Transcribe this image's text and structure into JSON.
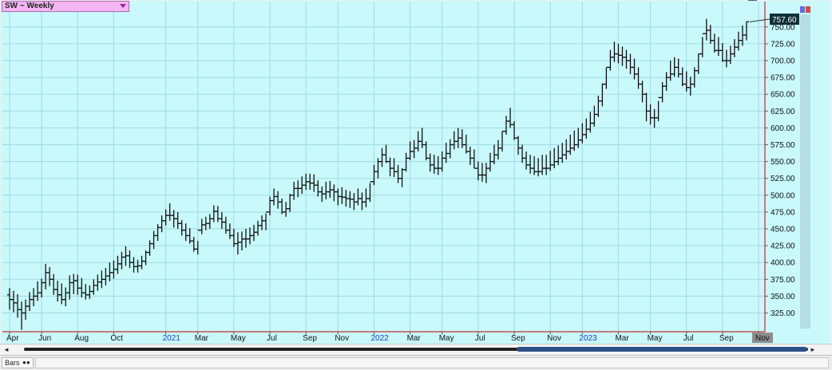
{
  "window": {
    "symbol_label": "SW ~ Weekly",
    "dropdown_icon": "chevron-down-icon",
    "status_tab_label": "Bars",
    "status_tab_icon": "infinity-icon"
  },
  "colors": {
    "plot_background": "#c9f9fb",
    "gridline": "#9fd9e4",
    "axis_line": "#c00000",
    "bar": "#111111",
    "price_label_bg": "#0f2f3a",
    "year_label": "#1a3fbf",
    "scroll_thumb": "#2b4f86"
  },
  "chart_data": {
    "type": "ohlc",
    "title": "SW ~ Weekly",
    "interval": "weekly",
    "last_price_label": "757.60",
    "y_axis": {
      "side": "right",
      "ylim": [
        310,
        770
      ],
      "ticks": [
        325,
        350,
        375,
        400,
        425,
        450,
        475,
        500,
        525,
        550,
        575,
        600,
        625,
        650,
        675,
        700,
        725,
        750
      ],
      "tick_labels": [
        "325.00",
        "350.00",
        "375.00",
        "400.00",
        "425.00",
        "450.00",
        "475.00",
        "500.00",
        "525.00",
        "550.00",
        "575.00",
        "600.00",
        "625.00",
        "650.00",
        "675.00",
        "700.00",
        "725.00",
        "750.00"
      ],
      "grid": true
    },
    "x_axis": {
      "start": "2020-04-06",
      "end": "2023-11-06",
      "grid": true,
      "ticks": [
        {
          "date": "2020-04-06",
          "label": "Apr",
          "is_year": false
        },
        {
          "date": "2020-06-01",
          "label": "Jun",
          "is_year": false
        },
        {
          "date": "2020-08-03",
          "label": "Aug",
          "is_year": false
        },
        {
          "date": "2020-10-05",
          "label": "Oct",
          "is_year": false
        },
        {
          "date": "2021-01-04",
          "label": "2021",
          "is_year": true
        },
        {
          "date": "2021-03-01",
          "label": "Mar",
          "is_year": false
        },
        {
          "date": "2021-05-03",
          "label": "May",
          "is_year": false
        },
        {
          "date": "2021-07-05",
          "label": "Jul",
          "is_year": false
        },
        {
          "date": "2021-09-06",
          "label": "Sep",
          "is_year": false
        },
        {
          "date": "2021-11-01",
          "label": "Nov",
          "is_year": false
        },
        {
          "date": "2022-01-03",
          "label": "2022",
          "is_year": true
        },
        {
          "date": "2022-03-07",
          "label": "Mar",
          "is_year": false
        },
        {
          "date": "2022-05-02",
          "label": "May",
          "is_year": false
        },
        {
          "date": "2022-07-04",
          "label": "Jul",
          "is_year": false
        },
        {
          "date": "2022-09-05",
          "label": "Sep",
          "is_year": false
        },
        {
          "date": "2022-11-07",
          "label": "Nov",
          "is_year": false
        },
        {
          "date": "2023-01-02",
          "label": "2023",
          "is_year": true
        },
        {
          "date": "2023-03-06",
          "label": "Mar",
          "is_year": false
        },
        {
          "date": "2023-05-01",
          "label": "May",
          "is_year": false
        },
        {
          "date": "2023-07-03",
          "label": "Jul",
          "is_year": false
        },
        {
          "date": "2023-09-04",
          "label": "Sep",
          "is_year": false
        },
        {
          "date": "2023-11-06",
          "label": "Nov",
          "is_year": false
        }
      ]
    },
    "series": [
      {
        "week_starting": [
          "2020-04-06",
          "2020-04-13",
          "2020-04-20",
          "2020-04-27",
          "2020-05-04",
          "2020-05-11",
          "2020-05-18",
          "2020-05-25",
          "2020-06-01",
          "2020-06-08",
          "2020-06-15",
          "2020-06-22",
          "2020-06-29",
          "2020-07-06",
          "2020-07-13",
          "2020-07-20",
          "2020-07-27",
          "2020-08-03",
          "2020-08-10",
          "2020-08-17",
          "2020-08-24",
          "2020-08-31",
          "2020-09-07",
          "2020-09-14",
          "2020-09-21",
          "2020-09-28",
          "2020-10-05",
          "2020-10-12",
          "2020-10-19",
          "2020-10-26",
          "2020-11-02",
          "2020-11-09",
          "2020-11-16",
          "2020-11-23",
          "2020-11-30",
          "2020-12-07",
          "2020-12-14",
          "2020-12-21",
          "2020-12-28",
          "2021-01-04",
          "2021-01-11",
          "2021-01-18",
          "2021-01-25",
          "2021-02-01",
          "2021-02-08",
          "2021-02-15",
          "2021-02-22",
          "2021-03-01",
          "2021-03-08",
          "2021-03-15",
          "2021-03-22",
          "2021-03-29",
          "2021-04-05",
          "2021-04-12",
          "2021-04-19",
          "2021-04-26",
          "2021-05-03",
          "2021-05-10",
          "2021-05-17",
          "2021-05-24",
          "2021-05-31",
          "2021-06-07",
          "2021-06-14",
          "2021-06-21",
          "2021-06-28",
          "2021-07-05",
          "2021-07-12",
          "2021-07-19",
          "2021-07-26",
          "2021-08-02",
          "2021-08-09",
          "2021-08-16",
          "2021-08-23",
          "2021-08-30",
          "2021-09-06",
          "2021-09-13",
          "2021-09-20",
          "2021-09-27",
          "2021-10-04",
          "2021-10-11",
          "2021-10-18",
          "2021-10-25",
          "2021-11-01",
          "2021-11-08",
          "2021-11-15",
          "2021-11-22",
          "2021-11-29",
          "2021-12-06",
          "2021-12-13",
          "2021-12-20",
          "2021-12-27",
          "2022-01-03",
          "2022-01-10",
          "2022-01-17",
          "2022-01-24",
          "2022-01-31",
          "2022-02-07",
          "2022-02-14",
          "2022-02-21",
          "2022-02-28",
          "2022-03-07",
          "2022-03-14",
          "2022-03-21",
          "2022-03-28",
          "2022-04-04",
          "2022-04-11",
          "2022-04-18",
          "2022-04-25",
          "2022-05-02",
          "2022-05-09",
          "2022-05-16",
          "2022-05-23",
          "2022-05-30",
          "2022-06-06",
          "2022-06-13",
          "2022-06-20",
          "2022-06-27",
          "2022-07-04",
          "2022-07-11",
          "2022-07-18",
          "2022-07-25",
          "2022-08-01",
          "2022-08-08",
          "2022-08-15",
          "2022-08-22",
          "2022-08-29",
          "2022-09-05",
          "2022-09-12",
          "2022-09-19",
          "2022-09-26",
          "2022-10-03",
          "2022-10-10",
          "2022-10-17",
          "2022-10-24",
          "2022-10-31",
          "2022-11-07",
          "2022-11-14",
          "2022-11-21",
          "2022-11-28",
          "2022-12-05",
          "2022-12-12",
          "2022-12-19",
          "2022-12-26",
          "2023-01-02",
          "2023-01-09",
          "2023-01-16",
          "2023-01-23",
          "2023-01-30",
          "2023-02-06",
          "2023-02-13",
          "2023-02-20",
          "2023-02-27",
          "2023-03-06",
          "2023-03-13",
          "2023-03-20",
          "2023-03-27",
          "2023-04-03",
          "2023-04-10",
          "2023-04-17",
          "2023-04-24",
          "2023-05-01",
          "2023-05-08",
          "2023-05-15",
          "2023-05-22",
          "2023-05-29",
          "2023-06-05",
          "2023-06-12",
          "2023-06-19",
          "2023-06-26",
          "2023-07-03",
          "2023-07-10",
          "2023-07-17",
          "2023-07-24",
          "2023-07-31",
          "2023-08-07",
          "2023-08-14",
          "2023-08-21",
          "2023-08-28",
          "2023-09-04",
          "2023-09-11",
          "2023-09-18",
          "2023-09-25",
          "2023-10-02",
          "2023-10-09",
          "2023-10-16",
          "2023-10-23",
          "2023-10-30"
        ],
        "high": [
          362,
          358,
          353,
          342,
          345,
          356,
          362,
          372,
          376,
          398,
          393,
          383,
          373,
          369,
          363,
          381,
          383,
          382,
          377,
          368,
          366,
          375,
          382,
          388,
          392,
          400,
          403,
          410,
          416,
          424,
          418,
          408,
          404,
          410,
          418,
          433,
          447,
          457,
          470,
          479,
          488,
          478,
          475,
          463,
          458,
          451,
          438,
          432,
          465,
          468,
          472,
          485,
          484,
          475,
          468,
          458,
          450,
          445,
          446,
          450,
          452,
          456,
          462,
          470,
          473,
          498,
          510,
          506,
          495,
          490,
          502,
          520,
          522,
          528,
          532,
          532,
          531,
          522,
          513,
          520,
          521,
          516,
          510,
          512,
          508,
          506,
          503,
          510,
          504,
          510,
          518,
          545,
          555,
          570,
          575,
          556,
          555,
          545,
          540,
          563,
          580,
          582,
          595,
          600,
          580,
          562,
          560,
          558,
          565,
          578,
          583,
          595,
          600,
          598,
          590,
          572,
          568,
          550,
          548,
          548,
          563,
          575,
          582,
          595,
          618,
          630,
          610,
          588,
          575,
          565,
          560,
          558,
          555,
          560,
          560,
          566,
          570,
          574,
          578,
          583,
          590,
          596,
          600,
          607,
          614,
          624,
          633,
          648,
          666,
          690,
          716,
          728,
          725,
          721,
          716,
          710,
          703,
          690,
          670,
          652,
          635,
          628,
          640,
          668,
          683,
          700,
          705,
          703,
          690,
          684,
          676,
          690,
          710,
          735,
          762,
          753,
          740,
          735,
          726,
          716,
          722,
          732,
          743,
          752,
          758
        ],
        "low": [
          330,
          326,
          318,
          300,
          315,
          328,
          335,
          343,
          348,
          360,
          365,
          352,
          342,
          338,
          335,
          345,
          353,
          352,
          348,
          345,
          346,
          352,
          358,
          362,
          366,
          372,
          376,
          383,
          390,
          395,
          392,
          385,
          385,
          390,
          396,
          410,
          420,
          432,
          445,
          455,
          462,
          452,
          450,
          440,
          432,
          428,
          416,
          412,
          442,
          448,
          450,
          460,
          460,
          450,
          443,
          435,
          423,
          412,
          418,
          422,
          427,
          432,
          440,
          448,
          448,
          470,
          485,
          480,
          472,
          468,
          475,
          493,
          497,
          502,
          508,
          508,
          505,
          498,
          490,
          494,
          496,
          491,
          485,
          487,
          483,
          481,
          478,
          485,
          478,
          482,
          490,
          515,
          525,
          542,
          548,
          528,
          527,
          518,
          512,
          535,
          552,
          555,
          565,
          570,
          552,
          535,
          532,
          530,
          535,
          548,
          555,
          568,
          570,
          570,
          562,
          545,
          540,
          522,
          520,
          518,
          535,
          546,
          553,
          565,
          590,
          600,
          582,
          560,
          548,
          538,
          532,
          530,
          528,
          530,
          530,
          536,
          540,
          545,
          548,
          553,
          560,
          566,
          570,
          577,
          584,
          593,
          602,
          616,
          632,
          658,
          685,
          698,
          696,
          692,
          688,
          680,
          672,
          658,
          638,
          610,
          605,
          600,
          610,
          638,
          655,
          670,
          676,
          675,
          662,
          654,
          648,
          660,
          680,
          705,
          730,
          725,
          712,
          707,
          698,
          690,
          695,
          705,
          715,
          722,
          730
        ],
        "open": [
          352,
          345,
          340,
          330,
          325,
          335,
          345,
          350,
          355,
          370,
          385,
          375,
          360,
          352,
          345,
          355,
          370,
          373,
          362,
          355,
          352,
          357,
          366,
          371,
          375,
          380,
          385,
          390,
          398,
          408,
          410,
          400,
          394,
          395,
          402,
          415,
          428,
          440,
          452,
          462,
          470,
          470,
          465,
          458,
          448,
          440,
          432,
          420,
          448,
          456,
          458,
          465,
          476,
          465,
          460,
          448,
          440,
          428,
          430,
          435,
          435,
          440,
          445,
          455,
          462,
          475,
          492,
          498,
          490,
          475,
          480,
          500,
          510,
          510,
          515,
          520,
          518,
          515,
          505,
          502,
          505,
          508,
          505,
          498,
          497,
          495,
          494,
          490,
          495,
          490,
          495,
          520,
          535,
          550,
          560,
          550,
          540,
          535,
          525,
          538,
          555,
          565,
          570,
          580,
          575,
          555,
          545,
          540,
          540,
          555,
          562,
          575,
          580,
          585,
          575,
          565,
          555,
          540,
          530,
          530,
          540,
          550,
          560,
          570,
          595,
          610,
          605,
          585,
          570,
          555,
          545,
          540,
          535,
          535,
          540,
          540,
          545,
          550,
          555,
          560,
          565,
          570,
          575,
          582,
          590,
          598,
          607,
          620,
          640,
          665,
          690,
          705,
          710,
          708,
          705,
          700,
          690,
          680,
          665,
          650,
          625,
          615,
          615,
          645,
          662,
          675,
          680,
          690,
          680,
          665,
          660,
          665,
          685,
          710,
          740,
          745,
          730,
          715,
          715,
          700,
          700,
          710,
          720,
          730,
          738
        ],
        "close": [
          345,
          340,
          330,
          325,
          335,
          345,
          350,
          355,
          370,
          385,
          375,
          360,
          352,
          345,
          355,
          370,
          373,
          362,
          355,
          352,
          357,
          366,
          371,
          375,
          380,
          385,
          390,
          398,
          408,
          410,
          400,
          394,
          395,
          402,
          415,
          428,
          440,
          452,
          462,
          470,
          470,
          465,
          458,
          448,
          440,
          432,
          420,
          448,
          456,
          458,
          465,
          476,
          465,
          460,
          448,
          440,
          428,
          430,
          435,
          435,
          440,
          445,
          455,
          462,
          475,
          492,
          498,
          490,
          475,
          480,
          500,
          510,
          510,
          515,
          520,
          518,
          515,
          505,
          502,
          505,
          508,
          505,
          498,
          497,
          495,
          494,
          490,
          495,
          490,
          495,
          520,
          535,
          550,
          560,
          550,
          540,
          535,
          525,
          538,
          555,
          565,
          570,
          580,
          575,
          555,
          545,
          540,
          540,
          555,
          562,
          575,
          580,
          585,
          575,
          565,
          555,
          540,
          530,
          530,
          540,
          550,
          560,
          570,
          595,
          610,
          605,
          585,
          570,
          555,
          545,
          540,
          535,
          535,
          540,
          540,
          545,
          550,
          555,
          560,
          565,
          570,
          575,
          582,
          590,
          598,
          607,
          620,
          640,
          665,
          690,
          705,
          710,
          708,
          705,
          700,
          690,
          680,
          665,
          650,
          625,
          615,
          615,
          645,
          662,
          675,
          680,
          690,
          680,
          665,
          660,
          665,
          685,
          710,
          740,
          745,
          730,
          715,
          715,
          700,
          700,
          710,
          720,
          730,
          738,
          757.6
        ]
      }
    ]
  }
}
